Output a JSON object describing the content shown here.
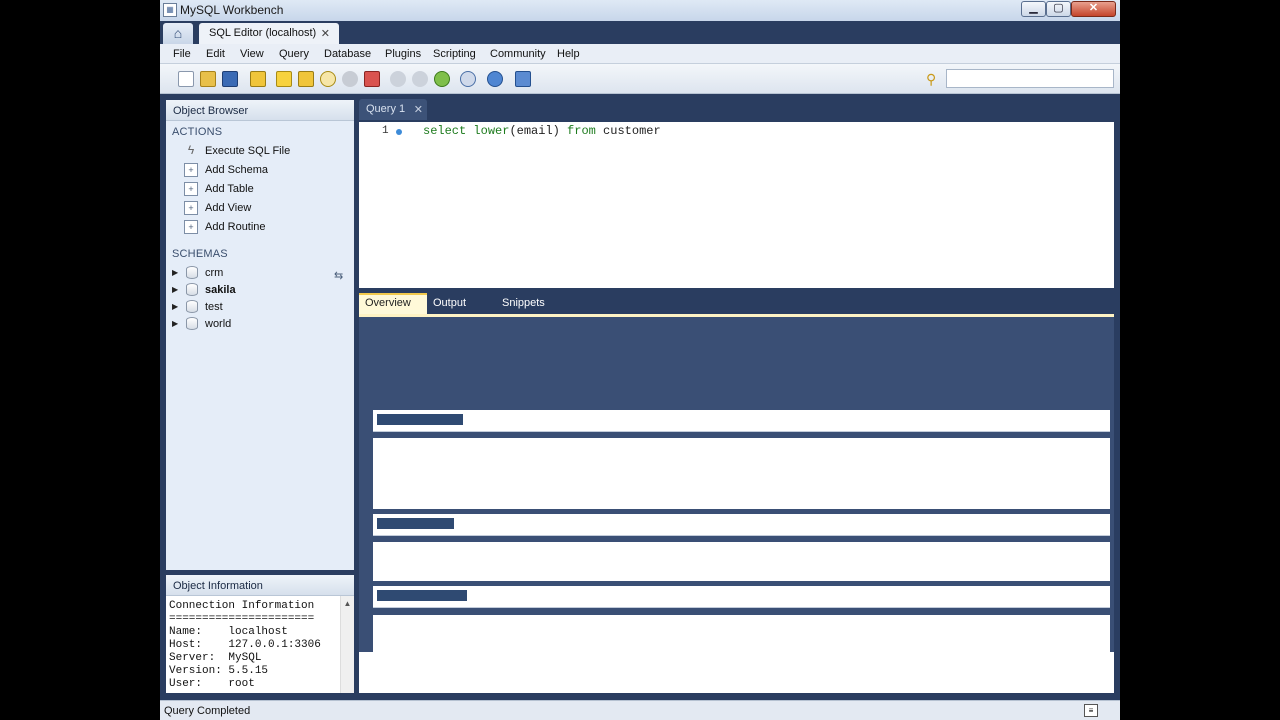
{
  "window": {
    "title": "MySQL Workbench"
  },
  "tabs": {
    "home_icon": "home-icon",
    "editor_tab": "SQL Editor (localhost)",
    "close": "✕"
  },
  "menu": [
    "File",
    "Edit",
    "View",
    "Query",
    "Database",
    "Plugins",
    "Scripting",
    "Community",
    "Help"
  ],
  "toolbar": {
    "icons": [
      "new-sql-file-icon",
      "open-sql-file-icon",
      "save-icon",
      "explain-icon",
      "execute-icon",
      "execute-current-icon",
      "search-icon",
      "stop-icon",
      "explain-query-icon",
      "commit-icon",
      "rollback-icon",
      "autocommit-icon",
      "reconnect-icon",
      "refresh-icon",
      "toggle-panel-icon"
    ],
    "search_value": ""
  },
  "object_browser": {
    "title": "Object Browser",
    "actions_title": "ACTIONS",
    "actions": [
      "Execute SQL File",
      "Add Schema",
      "Add Table",
      "Add View",
      "Add Routine"
    ],
    "schemas_title": "SCHEMAS",
    "schemas": [
      {
        "name": "crm",
        "bold": false
      },
      {
        "name": "sakila",
        "bold": true
      },
      {
        "name": "test",
        "bold": false
      },
      {
        "name": "world",
        "bold": false
      }
    ]
  },
  "object_info": {
    "title": "Object Information",
    "lines": [
      "Connection Information",
      "======================",
      "Name:    localhost",
      "Host:    127.0.0.1:3306",
      "Server:  MySQL",
      "Version: 5.5.15",
      "User:    root"
    ]
  },
  "query": {
    "tab": "Query 1",
    "line_number": "1",
    "sql_tokens": [
      {
        "t": "select",
        "c": "kw"
      },
      {
        "t": " ",
        "c": "id"
      },
      {
        "t": "lower",
        "c": "fn"
      },
      {
        "t": "(email) ",
        "c": "id"
      },
      {
        "t": "from",
        "c": "kw"
      },
      {
        "t": " customer",
        "c": "id"
      }
    ]
  },
  "results": {
    "tabs": [
      "Overview",
      "Output",
      "Snippets"
    ]
  },
  "status": {
    "text": "Query Completed"
  }
}
